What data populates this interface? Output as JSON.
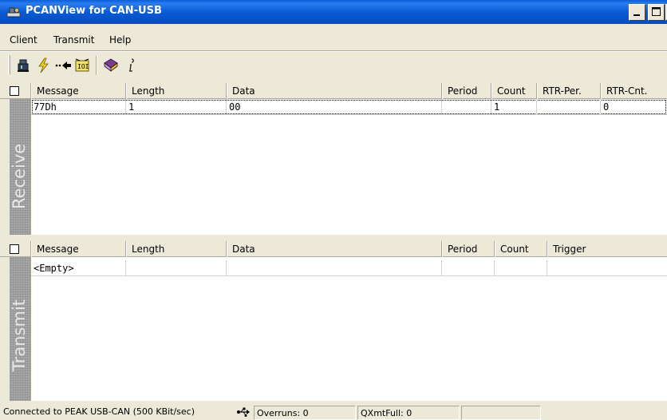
{
  "window": {
    "title": "PCANView for CAN-USB",
    "buttons": {
      "minimize": "_",
      "maximize": "□",
      "close": "x"
    }
  },
  "menu": [
    "Client",
    "Transmit",
    "Help"
  ],
  "toolbar": {
    "icons": [
      "connect-icon",
      "flash-icon",
      "arrow-left-icon",
      "counter-icon",
      "help-book-icon",
      "info-icon"
    ]
  },
  "receive": {
    "side_label": "Receive",
    "columns": [
      "Message",
      "Length",
      "Data",
      "Period",
      "Count",
      "RTR-Per.",
      "RTR-Cnt."
    ],
    "rows": [
      {
        "message": "77Dh",
        "length": "1",
        "data": "00",
        "period": "",
        "count": "1",
        "rtr_per": "",
        "rtr_cnt": "0"
      }
    ]
  },
  "transmit": {
    "side_label": "Transmit",
    "columns": [
      "Message",
      "Length",
      "Data",
      "Period",
      "Count",
      "Trigger"
    ],
    "rows": [
      {
        "message": "<Empty>",
        "length": "",
        "data": "",
        "period": "",
        "count": "",
        "trigger": ""
      }
    ]
  },
  "status": {
    "connection": "Connected to PEAK USB-CAN (500 KBit/sec)",
    "overruns": "Overruns: 0",
    "qxmtfull": "QXmtFull: 0"
  },
  "colors": {
    "titlebar": "#0b5bd3",
    "face": "#ece9d8",
    "side_strip": "#a8a8a8"
  }
}
